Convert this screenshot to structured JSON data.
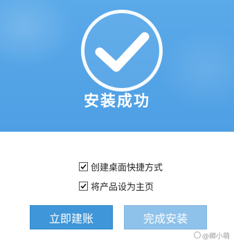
{
  "dialog": {
    "title": "安装成功",
    "status_icon": "check-circle-icon",
    "options": [
      {
        "label": "创建桌面快捷方式",
        "checked": true
      },
      {
        "label": "将产品设为主页",
        "checked": true
      }
    ],
    "buttons": {
      "primary": "立即建账",
      "secondary": "完成安装"
    }
  },
  "watermark": {
    "text": "@卿小萌"
  },
  "colors": {
    "header_bg": "#4e9fe4",
    "primary_button": "#3f96d8",
    "secondary_button": "#8fc2ea"
  }
}
